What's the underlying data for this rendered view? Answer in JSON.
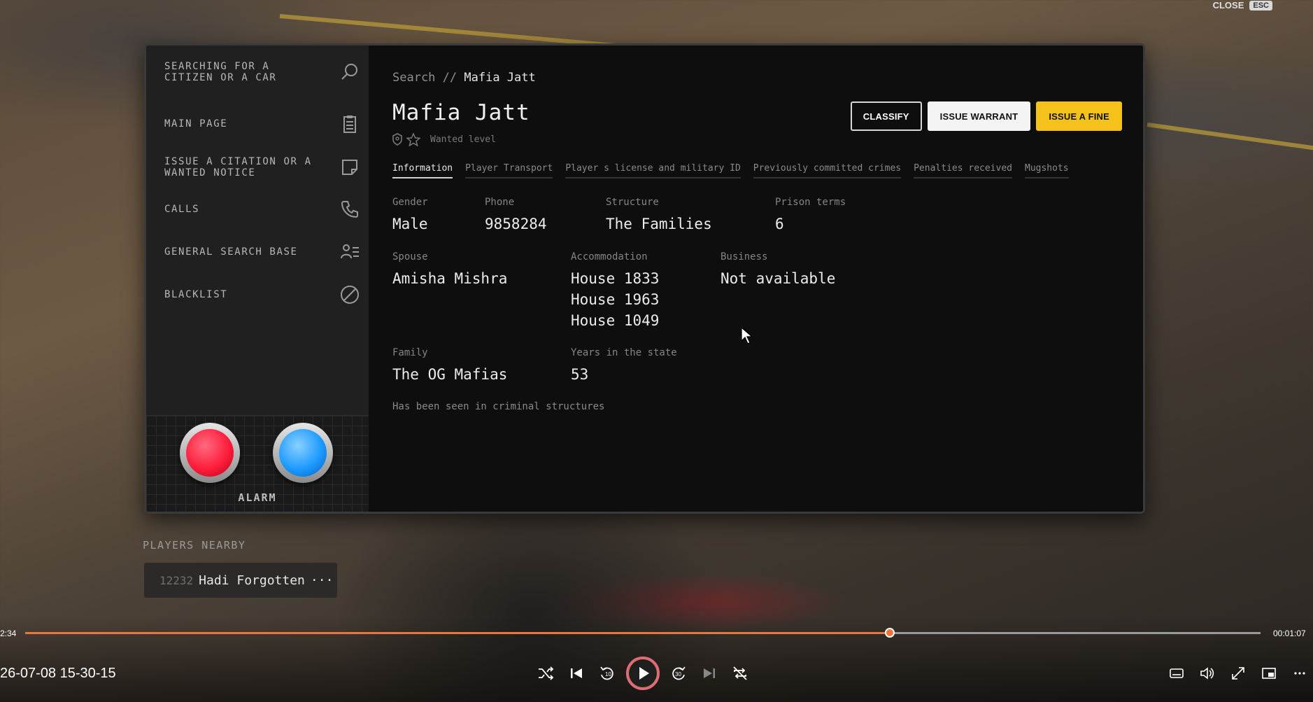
{
  "overlay": {
    "close_label": "CLOSE",
    "esc_key": "ESC"
  },
  "sidebar": {
    "items": [
      {
        "label": "SEARCHING FOR A CITIZEN OR A CAR",
        "icon": "search-icon"
      },
      {
        "label": "MAIN PAGE",
        "icon": "clipboard-icon"
      },
      {
        "label": "ISSUE A CITATION OR A WANTED NOTICE",
        "icon": "note-icon"
      },
      {
        "label": "CALLS",
        "icon": "phone-icon"
      },
      {
        "label": "GENERAL SEARCH BASE",
        "icon": "user-list-icon"
      },
      {
        "label": "BLACKLIST",
        "icon": "ban-icon"
      }
    ],
    "alarm_label": "ALARM",
    "alarm_colors": {
      "red": "#ff1e3c",
      "blue": "#1e9bff"
    }
  },
  "breadcrumb": {
    "root": "Search //",
    "current": "Mafia Jatt"
  },
  "profile": {
    "name": "Mafia Jatt",
    "wanted_label": "Wanted level",
    "actions": {
      "classify": "CLASSIFY",
      "warrant": "ISSUE WARRANT",
      "fine": "ISSUE A FINE"
    },
    "tabs": [
      "Information",
      "Player Transport",
      "Player s license and military ID",
      "Previously committed crimes",
      "Penalties received",
      "Mugshots"
    ],
    "active_tab": "Information",
    "fields": {
      "gender": {
        "label": "Gender",
        "value": "Male"
      },
      "phone": {
        "label": "Phone",
        "value": "9858284"
      },
      "structure": {
        "label": "Structure",
        "value": "The Families"
      },
      "prison": {
        "label": "Prison terms",
        "value": "6"
      },
      "spouse": {
        "label": "Spouse",
        "value": "Amisha Mishra"
      },
      "accommodation": {
        "label": "Accommodation",
        "values": [
          "House 1833",
          "House 1963",
          "House 1049"
        ]
      },
      "business": {
        "label": "Business",
        "value": "Not available"
      },
      "family": {
        "label": "Family",
        "value": "The OG Mafias"
      },
      "years": {
        "label": "Years in the state",
        "value": "53"
      }
    },
    "note": "Has been seen in criminal structures"
  },
  "players_nearby": {
    "header": "PLAYERS NEARBY",
    "players": [
      {
        "id": "12232",
        "name": "Hadi Forgotten",
        "more": "···"
      }
    ]
  },
  "media": {
    "elapsed": "2:34",
    "remaining": "00:01:07",
    "progress": 0.7,
    "timestamp": "26-07-08 15-30-15",
    "accent": "#f0743a"
  }
}
